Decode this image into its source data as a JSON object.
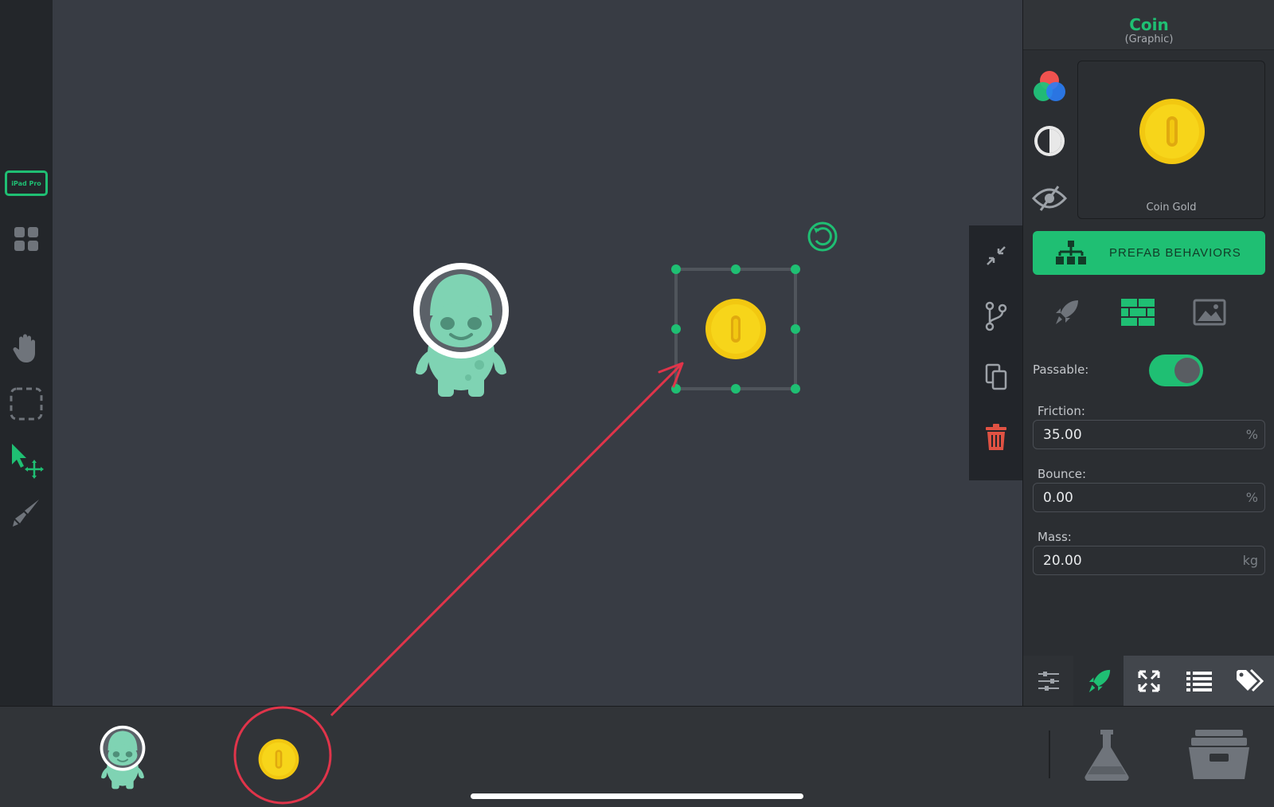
{
  "device_label": "iPad Pro",
  "inspector": {
    "title": "Coin",
    "subtitle": "(Graphic)",
    "preview_label": "Coin Gold",
    "prefab_button": "PREFAB BEHAVIORS",
    "passable": {
      "label": "Passable:",
      "value": true
    },
    "fields": [
      {
        "label": "Friction:",
        "value": "35.00",
        "unit": "%"
      },
      {
        "label": "Bounce:",
        "value": "0.00",
        "unit": "%"
      },
      {
        "label": "Mass:",
        "value": "20.00",
        "unit": "kg"
      }
    ],
    "bottom_tabs": [
      "sliders-icon",
      "rocket-icon",
      "fullscreen-icon",
      "list-icon",
      "tags-icon"
    ],
    "active_bottom_tab": "rocket-icon"
  },
  "left_tools": [
    "device-icon",
    "grid-icon",
    "hand-icon",
    "marquee-select-icon",
    "move-select-icon",
    "paint-brush-icon"
  ],
  "object_tools": [
    "shrink-icon",
    "branch-icon",
    "copy-icon",
    "trash-icon"
  ],
  "library": [
    "alien-icon",
    "coin-icon",
    "flask-icon",
    "archive-box-icon"
  ],
  "colors": {
    "accent": "#1fbf73",
    "annotation": "#e0344a",
    "coin": "#f2c811",
    "alien": "#7fd3b3",
    "trash": "#e05243"
  }
}
